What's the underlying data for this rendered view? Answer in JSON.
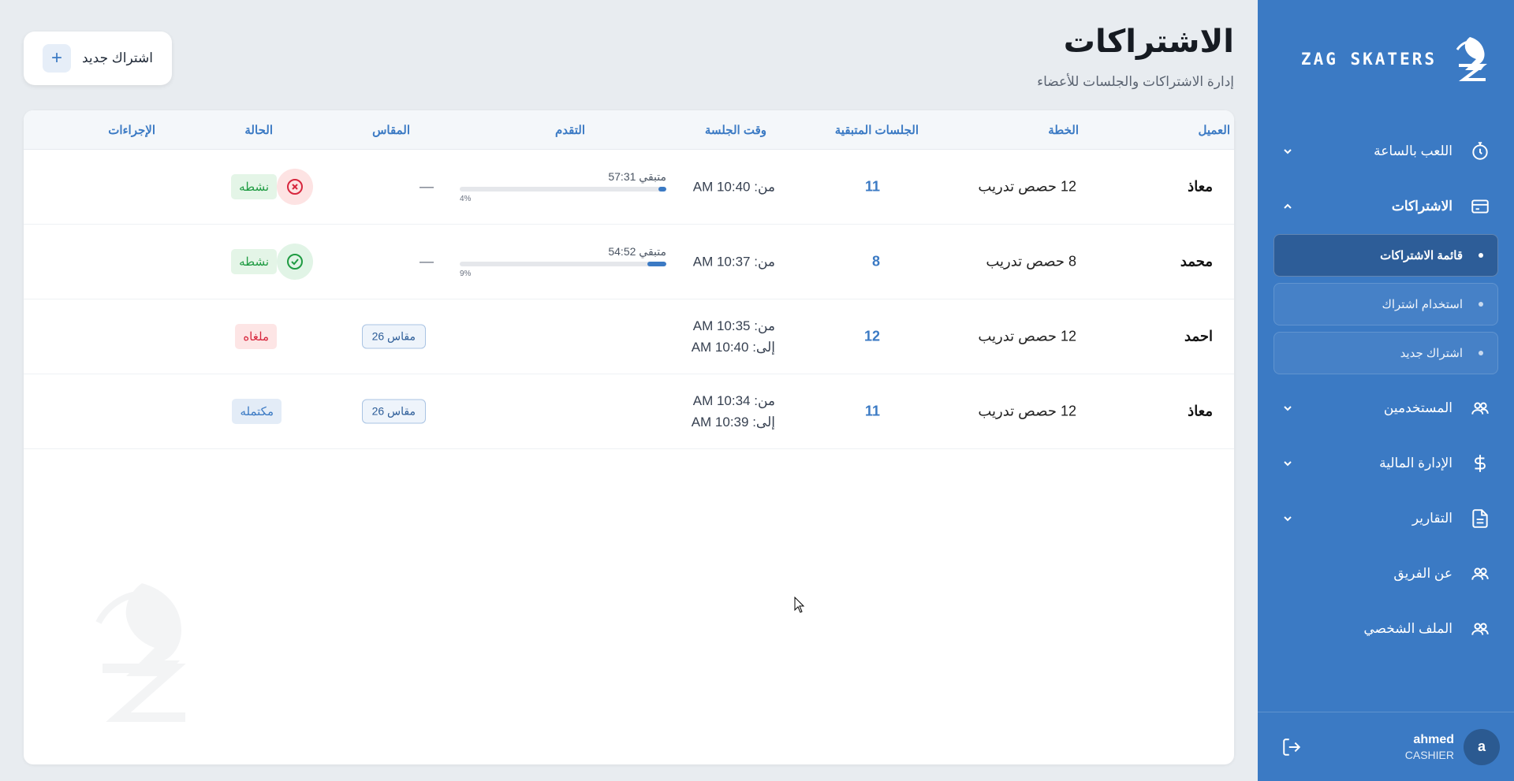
{
  "sidebar": {
    "brand": "ZAG SKATERS",
    "items": [
      {
        "label": "اللعب بالساعة",
        "icon": "timer-icon"
      },
      {
        "label": "الاشتراكات",
        "icon": "card-icon"
      },
      {
        "label": "المستخدمين",
        "icon": "users-icon"
      },
      {
        "label": "الإدارة المالية",
        "icon": "dollar-icon"
      },
      {
        "label": "التقارير",
        "icon": "document-icon"
      },
      {
        "label": "عن الفريق",
        "icon": "users-icon"
      },
      {
        "label": "الملف الشخصي",
        "icon": "users-icon"
      }
    ],
    "subitems": [
      {
        "label": "قائمة الاشتراكات"
      },
      {
        "label": "استخدام اشتراك"
      },
      {
        "label": "اشتراك جديد"
      }
    ],
    "user": {
      "initial": "a",
      "name": "ahmed",
      "role": "CASHIER"
    }
  },
  "header": {
    "title": "الاشتراكات",
    "subtitle": "إدارة الاشتراكات والجلسات للأعضاء",
    "new_button": "اشتراك جديد"
  },
  "table": {
    "columns": [
      "العميل",
      "الخطة",
      "الجلسات المتبقية",
      "وقت الجلسة",
      "التقدم",
      "المقاس",
      "الحالة",
      "الإجراءات"
    ],
    "rows": [
      {
        "client": "معاذ",
        "plan": "12 حصص تدريب",
        "remaining": "11",
        "time_from": "من: AM 10:40",
        "time_to": "",
        "progress_text": "متبقي 57:31",
        "progress_pct": "4%",
        "progress": 0.04,
        "size": "—",
        "size_pill": false,
        "status": "نشطه",
        "status_type": "active",
        "action": "cancel"
      },
      {
        "client": "محمد",
        "plan": "8 حصص تدريب",
        "remaining": "8",
        "time_from": "من: AM 10:37",
        "time_to": "",
        "progress_text": "متبقي 54:52",
        "progress_pct": "9%",
        "progress": 0.09,
        "size": "—",
        "size_pill": false,
        "status": "نشطه",
        "status_type": "active",
        "action": "confirm"
      },
      {
        "client": "احمد",
        "plan": "12 حصص تدريب",
        "remaining": "12",
        "time_from": "من: AM 10:35",
        "time_to": "إلى: AM 10:40",
        "progress_text": "",
        "progress_pct": "",
        "progress": null,
        "size": "مقاس 26",
        "size_pill": true,
        "status": "ملغاه",
        "status_type": "cancel",
        "action": ""
      },
      {
        "client": "معاذ",
        "plan": "12 حصص تدريب",
        "remaining": "11",
        "time_from": "من: AM 10:34",
        "time_to": "إلى: AM 10:39",
        "progress_text": "",
        "progress_pct": "",
        "progress": null,
        "size": "مقاس 26",
        "size_pill": true,
        "status": "مكتمله",
        "status_type": "done",
        "action": ""
      }
    ]
  },
  "colors": {
    "primary": "#3b7ac4",
    "active": "#1f9b42",
    "cancel": "#d7263d"
  }
}
